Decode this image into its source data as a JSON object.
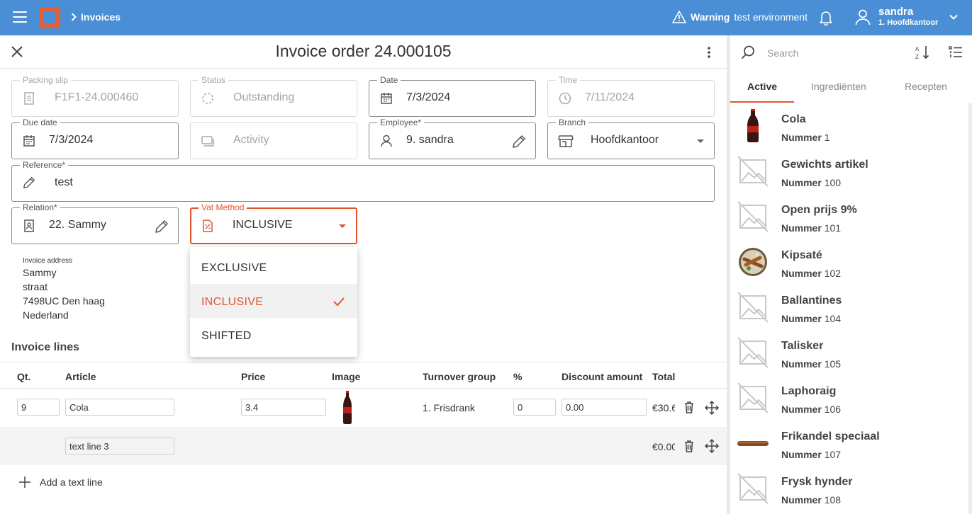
{
  "topbar": {
    "breadcrumb": "Invoices",
    "warning_bold": "Warning",
    "warning_text": "test environment",
    "user_name": "sandra",
    "user_branch": "1. Hoofdkantoor"
  },
  "page": {
    "title": "Invoice order 24.000105"
  },
  "form": {
    "packing_slip": {
      "label": "Packing slip",
      "value": "F1F1-24.000460"
    },
    "status": {
      "label": "Status",
      "value": "Outstanding"
    },
    "date": {
      "label": "Date",
      "value": "7/3/2024"
    },
    "time": {
      "label": "Time",
      "value": "7/11/2024"
    },
    "due_date": {
      "label": "Due date",
      "value": "7/3/2024"
    },
    "activity": {
      "placeholder": "Activity"
    },
    "employee": {
      "label": "Employee*",
      "value": "9. sandra"
    },
    "branch": {
      "label": "Branch",
      "value": "Hoofdkantoor"
    },
    "reference": {
      "label": "Reference*",
      "value": "test"
    },
    "relation": {
      "label": "Relation*",
      "value": "22. Sammy"
    },
    "vat_method": {
      "label": "Vat Method",
      "value": "INCLUSIVE"
    }
  },
  "vat_options": [
    "EXCLUSIVE",
    "INCLUSIVE",
    "SHIFTED"
  ],
  "vat_selected_index": 1,
  "address": {
    "label": "Invoice address",
    "lines": [
      "Sammy",
      "straat",
      "7498UC Den haag",
      "Nederland"
    ]
  },
  "invoice_lines": {
    "title": "Invoice lines",
    "headers": {
      "qty": "Qt.",
      "article": "Article",
      "price": "Price",
      "image": "Image",
      "turnover": "Turnover group",
      "percent": "%",
      "discount": "Discount amount",
      "total": "Total"
    },
    "rows": [
      {
        "qty": "9",
        "article": "Cola",
        "price": "3.4",
        "turnover": "1. Frisdrank",
        "percent": "0",
        "discount": "0.00",
        "total": "€30.6"
      },
      {
        "article": "text line 3",
        "total": "€0.00"
      }
    ],
    "add_text_line": "Add a text line"
  },
  "sidebar": {
    "search_placeholder": "Search",
    "tabs": [
      "Active",
      "Ingrediënten",
      "Recepten"
    ],
    "number_label": "Nummer",
    "products": [
      {
        "name": "Cola",
        "number": "1",
        "image": "cola-bottle"
      },
      {
        "name": "Gewichts artikel",
        "number": "100",
        "image": "no-image"
      },
      {
        "name": "Open prijs 9%",
        "number": "101",
        "image": "no-image"
      },
      {
        "name": "Kipsaté",
        "number": "102",
        "image": "satay-plate"
      },
      {
        "name": "Ballantines",
        "number": "104",
        "image": "no-image"
      },
      {
        "name": "Talisker",
        "number": "105",
        "image": "no-image"
      },
      {
        "name": "Laphoraig",
        "number": "106",
        "image": "no-image"
      },
      {
        "name": "Frikandel speciaal",
        "number": "107",
        "image": "frikandel"
      },
      {
        "name": "Frysk hynder",
        "number": "108",
        "image": "no-image"
      }
    ]
  },
  "colors": {
    "topbar": "#4a8fd6",
    "accent": "#e0552e"
  }
}
